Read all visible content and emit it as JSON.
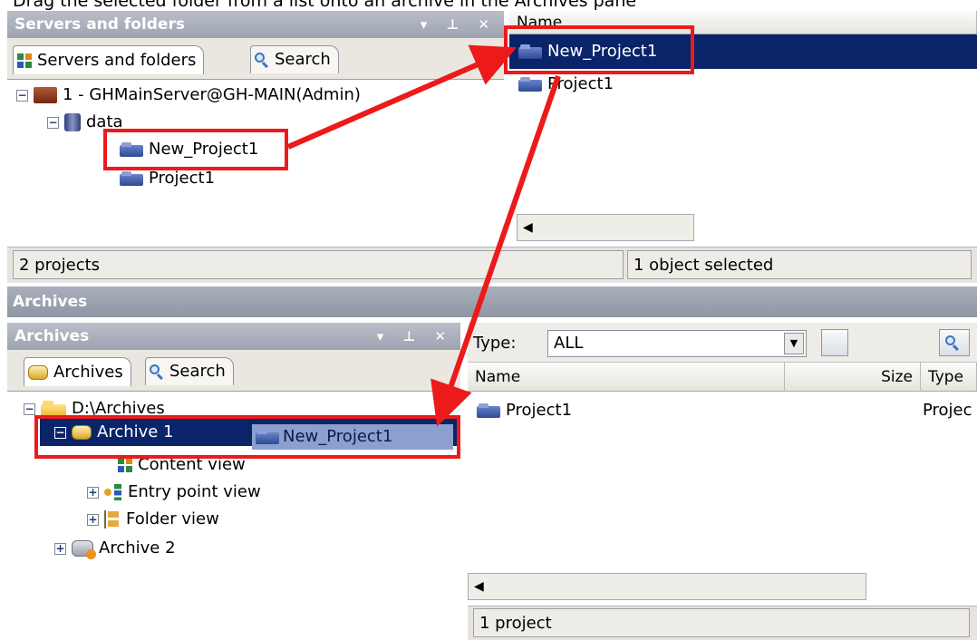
{
  "caption": "Drag the selected folder from a list onto an archive in the Archives pane",
  "servers_panel": {
    "title": "Servers and folders",
    "controls": "▾ ⊥ ✕",
    "tabs": [
      {
        "label": "Servers and folders"
      },
      {
        "label": "Search"
      }
    ],
    "tree": {
      "server": "1 - GHMainServer@GH-MAIN(Admin)",
      "database": "data",
      "projects": [
        "New_Project1",
        "Project1"
      ]
    },
    "status": "2 projects"
  },
  "servers_list": {
    "column_name": "Name",
    "rows": [
      "New_Project1",
      "Project1"
    ],
    "status": "1 object selected"
  },
  "archives_section": {
    "title": "Archives"
  },
  "archives_panel": {
    "title": "Archives",
    "controls": "▾ ⊥ ✕",
    "tabs": [
      {
        "label": "Archives"
      },
      {
        "label": "Search"
      }
    ],
    "tree": {
      "root": "D:\\Archives",
      "archive1": "Archive 1",
      "drag_item": "New_Project1",
      "views": [
        "Content view",
        "Entry point view",
        "Folder view"
      ],
      "archive2": "Archive 2"
    }
  },
  "archives_list": {
    "type_label": "Type:",
    "type_value": "ALL",
    "columns": {
      "name": "Name",
      "size": "Size",
      "type": "Type"
    },
    "rows": [
      {
        "name": "Project1",
        "type": "Projec"
      }
    ],
    "status": "1 project"
  },
  "colors": {
    "selection": "#0a246a",
    "highlight_box": "#ec1a1a",
    "titlebar": "#a9afbb"
  }
}
